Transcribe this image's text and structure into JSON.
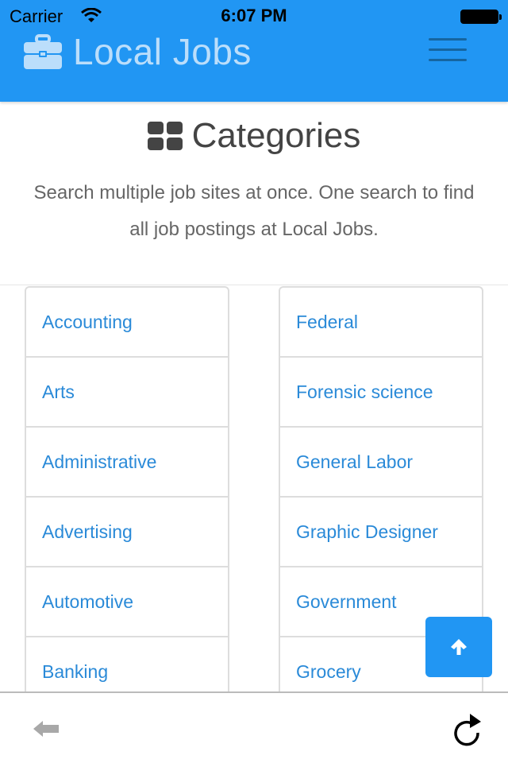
{
  "status_bar": {
    "carrier": "Carrier",
    "time": "6:07 PM"
  },
  "header": {
    "title": "Local Jobs",
    "brand_icon": "briefcase-icon",
    "menu_icon": "hamburger-menu-icon"
  },
  "main": {
    "heading": "Categories",
    "heading_icon": "grid-icon",
    "intro": "Search multiple job sites at once. One search to find all job postings at Local Jobs."
  },
  "categories": {
    "left": [
      {
        "label": "Accounting"
      },
      {
        "label": "Arts"
      },
      {
        "label": "Administrative"
      },
      {
        "label": "Advertising"
      },
      {
        "label": "Automotive"
      },
      {
        "label": "Banking"
      }
    ],
    "right": [
      {
        "label": "Federal"
      },
      {
        "label": "Forensic science"
      },
      {
        "label": "General Labor"
      },
      {
        "label": "Graphic Designer"
      },
      {
        "label": "Government"
      },
      {
        "label": "Grocery"
      }
    ]
  },
  "scroll_top": {
    "icon": "arrow-up-icon"
  },
  "toolbar": {
    "back_icon": "back-arrow-icon",
    "reload_icon": "reload-icon"
  },
  "colors": {
    "primary": "#2196f3",
    "link": "#2a8ad8",
    "brand_text": "#bbdefb"
  }
}
